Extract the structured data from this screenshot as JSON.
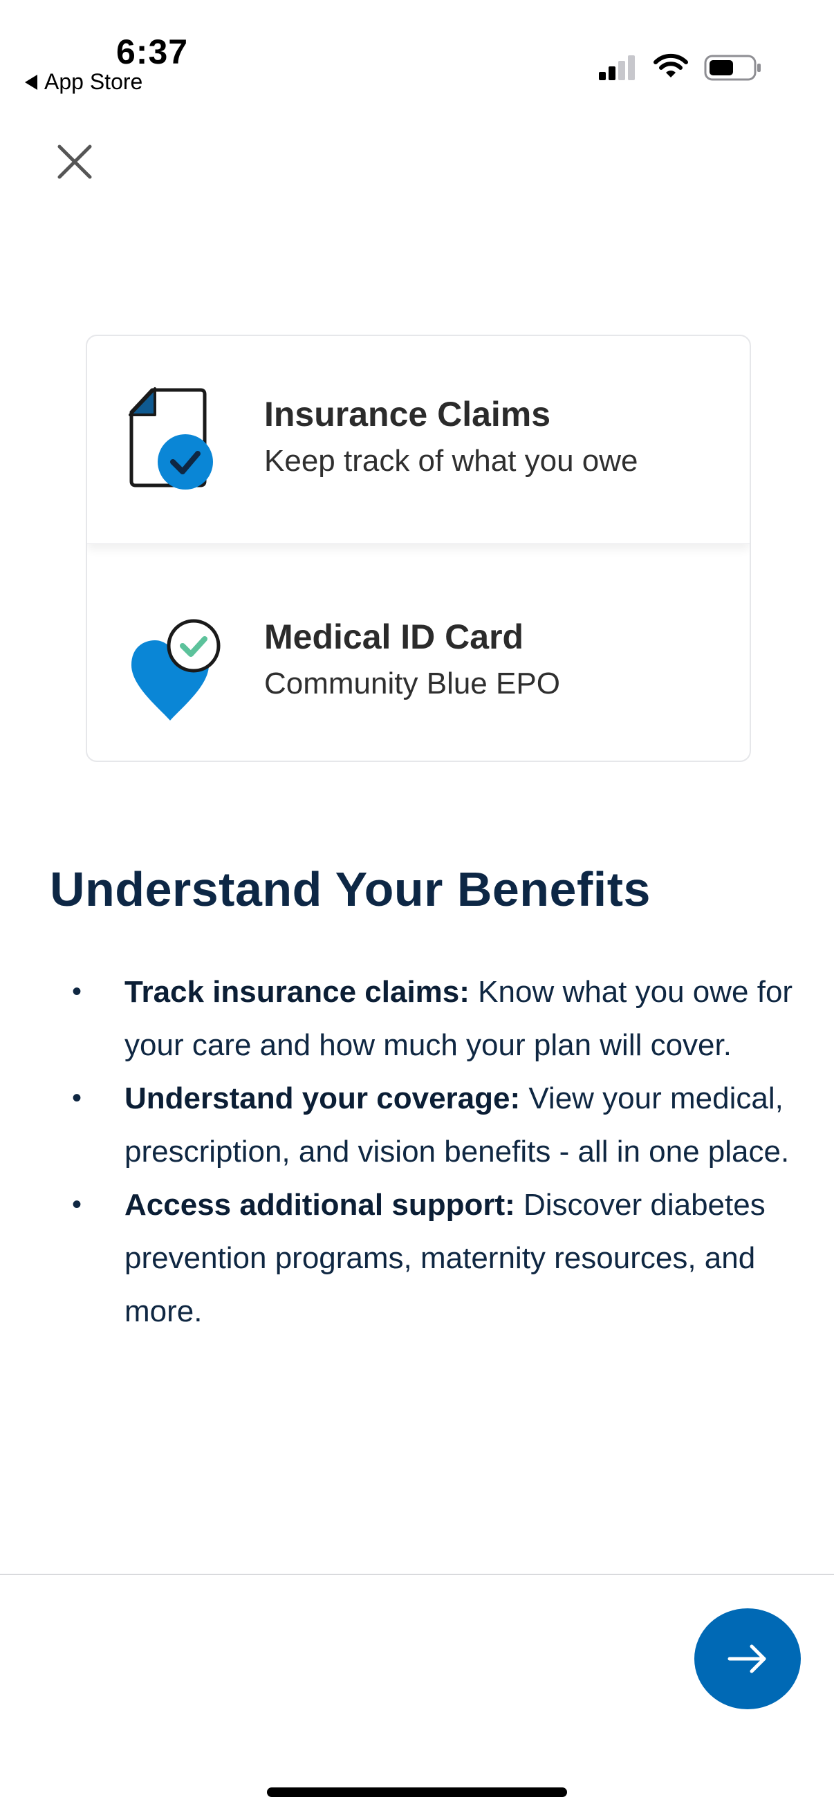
{
  "status_bar": {
    "time": "6:37",
    "back_label": "App Store"
  },
  "colors": {
    "accent": "#0069B5",
    "heading": "#0D2745",
    "text": "#0F2742",
    "check_green": "#5CC29B"
  },
  "close_icon": "close-icon",
  "cards": [
    {
      "title": "Insurance Claims",
      "subtitle": "Keep track of what you owe",
      "icon": "claims-document-check-icon"
    },
    {
      "title": "Medical ID Card",
      "subtitle": "Community Blue EPO",
      "icon": "heart-check-icon"
    }
  ],
  "section": {
    "title": "Understand Your Benefits",
    "bullets": [
      {
        "bold": "Track insurance claims:",
        "text": " Know what you owe for your care and how much your plan will cover."
      },
      {
        "bold": "Understand your coverage:",
        "text": " View your medical, prescription, and vision benefits - all in one place."
      },
      {
        "bold": "Access additional support:",
        "text": " Discover diabetes prevention programs, maternity resources, and more."
      }
    ]
  },
  "next_button_icon": "arrow-right-icon"
}
